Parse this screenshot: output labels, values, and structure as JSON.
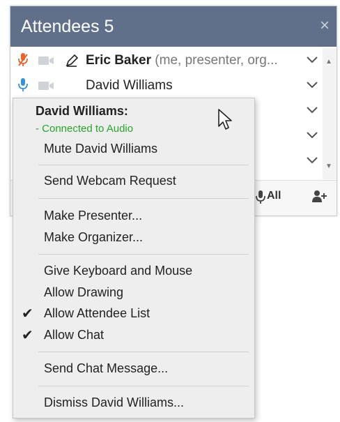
{
  "panel": {
    "title": "Attendees 5",
    "close_glyph": "×"
  },
  "attendees": [
    {
      "name": "Eric Baker",
      "role": "(me, presenter, org...",
      "mic_color": "#e8642b"
    },
    {
      "name": "David Williams",
      "role": "",
      "mic_color": "#3a8fd9"
    }
  ],
  "footer": {
    "mute_all_label": "All"
  },
  "context_menu": {
    "header": "David Williams:",
    "status": "- Connected to Audio",
    "status_color": "#29a329",
    "items": {
      "mute": "Mute David Williams",
      "webcam": "Send Webcam Request",
      "presenter": "Make Presenter...",
      "organizer": "Make Organizer...",
      "keyboard_mouse": "Give Keyboard and Mouse",
      "drawing": "Allow Drawing",
      "attendee_list": "Allow Attendee List",
      "chat": "Allow Chat",
      "chat_message": "Send Chat Message...",
      "dismiss": "Dismiss David Williams..."
    },
    "checked": [
      "attendee_list",
      "chat"
    ]
  },
  "colors": {
    "titlebar": "#60708a"
  }
}
